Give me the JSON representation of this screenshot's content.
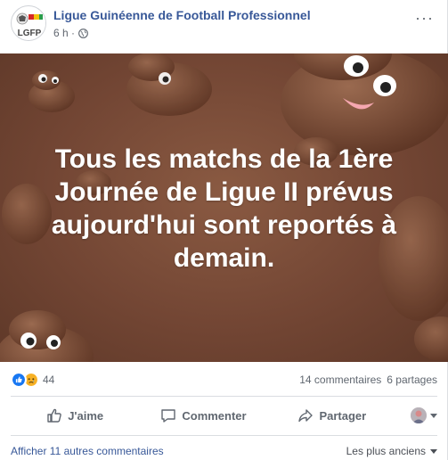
{
  "header": {
    "page_name": "Ligue Guinéenne de Football Professionnel",
    "timestamp": "6 h ·",
    "more_label": "···",
    "privacy_icon": "globe-icon"
  },
  "post": {
    "text": "Tous les matchs de la 1ère Journée de Ligue II prévus aujourd'hui sont reportés à demain.",
    "background_color": "#7a4a36"
  },
  "reactions": {
    "icons": [
      "like-icon",
      "sad-icon"
    ],
    "count": "44",
    "comments": "14 commentaires",
    "shares": "6 partages"
  },
  "actions": {
    "like_label": "J'aime",
    "comment_label": "Commenter",
    "share_label": "Partager"
  },
  "footer": {
    "more_comments": "Afficher 11 autres commentaires",
    "sort_label": "Les plus anciens"
  },
  "colors": {
    "link": "#385898",
    "like_blue": "#1877f2",
    "sad_yellow": "#f7b125"
  }
}
